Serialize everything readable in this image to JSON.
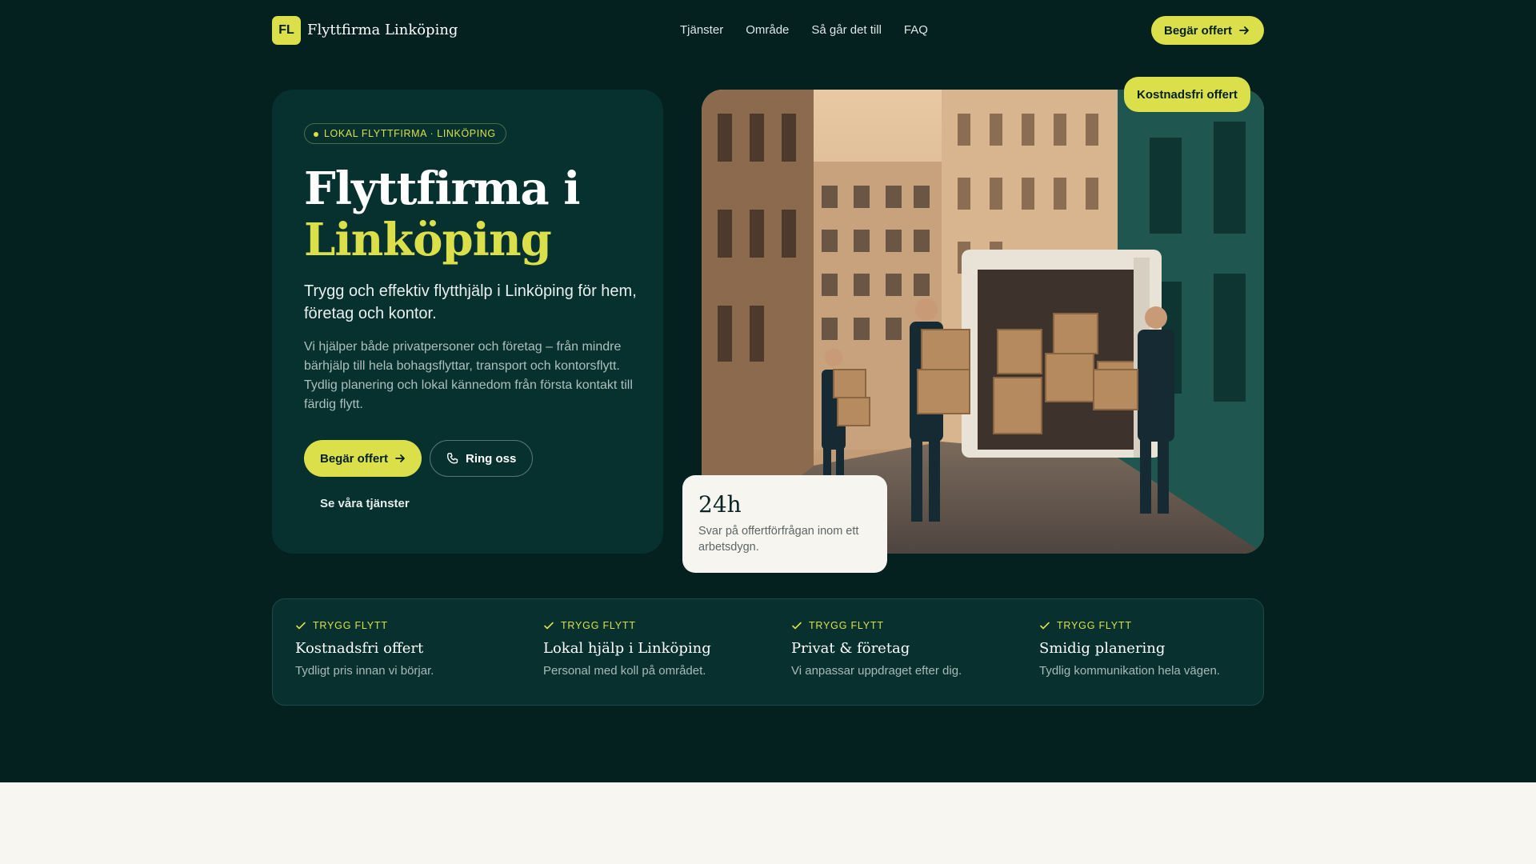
{
  "colors": {
    "background": "#04201f",
    "card": "#06312f",
    "accent": "#dbe04a",
    "page_bottom": "#f7f6f1"
  },
  "nav": {
    "logo_mark": "FL",
    "brand": "Flyttfirma Linköping",
    "links": [
      "Tjänster",
      "Område",
      "Så går det till",
      "FAQ"
    ],
    "cta_label": "Begär offert",
    "cta_icon": "arrow-right-icon"
  },
  "hero": {
    "tag": "LOKAL FLYTTFIRMA · LINKÖPING",
    "title_line1": "Flyttfirma i",
    "title_line2": "Linköping",
    "lead": "Trygg och effektiv flytthjälp i Linköping för hem, företag och kontor.",
    "body": "Vi hjälper både privatpersoner och företag – från mindre bärhjälp till hela bohagsflyttar, transport och kontorsflytt. Tydlig planering och lokal kännedom från första kontakt till färdig flytt.",
    "primary_label": "Begär offert",
    "call_label": "Ring oss",
    "call_icon": "phone-icon",
    "services_link": "Se våra tjänster"
  },
  "photo": {
    "badge": "Kostnadsfri offert",
    "stat_value": "24h",
    "stat_text": "Svar på offertförfrågan inom ett arbetsdygn."
  },
  "features": [
    {
      "tag": "TRYGG FLYTT",
      "title": "Kostnadsfri offert",
      "desc": "Tydligt pris innan vi börjar."
    },
    {
      "tag": "TRYGG FLYTT",
      "title": "Lokal hjälp i Linköping",
      "desc": "Personal med koll på området."
    },
    {
      "tag": "TRYGG FLYTT",
      "title": "Privat & företag",
      "desc": "Vi anpassar uppdraget efter dig."
    },
    {
      "tag": "TRYGG FLYTT",
      "title": "Smidig planering",
      "desc": "Tydlig kommunikation hela vägen."
    }
  ]
}
